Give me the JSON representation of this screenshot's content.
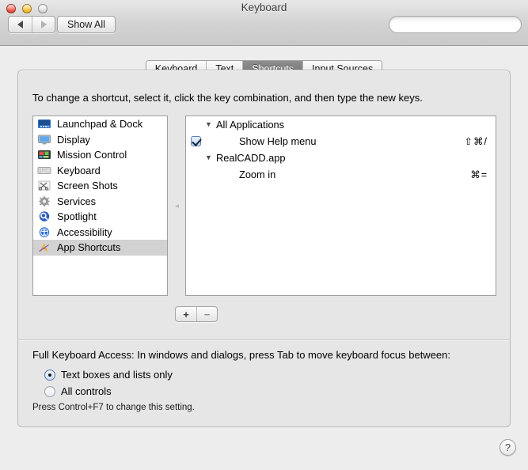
{
  "window": {
    "title": "Keyboard",
    "traffic_lights": [
      "close",
      "minimize",
      "zoom"
    ]
  },
  "toolbar": {
    "back_icon": "back-arrow-icon",
    "forward_icon": "forward-arrow-icon",
    "show_all_label": "Show All",
    "search_placeholder": "",
    "search_value": "",
    "search_icon": "search-icon"
  },
  "tabs": [
    {
      "label": "Keyboard",
      "active": false
    },
    {
      "label": "Text",
      "active": false
    },
    {
      "label": "Shortcuts",
      "active": true
    },
    {
      "label": "Input Sources",
      "active": false
    }
  ],
  "main": {
    "hint": "To change a shortcut, select it, click the key combination, and then type the new keys.",
    "sidebar": [
      {
        "label": "Launchpad & Dock",
        "icon": "launchpad-dock-icon",
        "selected": false
      },
      {
        "label": "Display",
        "icon": "display-icon",
        "selected": false
      },
      {
        "label": "Mission Control",
        "icon": "mission-control-icon",
        "selected": false
      },
      {
        "label": "Keyboard",
        "icon": "keyboard-icon",
        "selected": false
      },
      {
        "label": "Screen Shots",
        "icon": "screenshots-icon",
        "selected": false
      },
      {
        "label": "Services",
        "icon": "services-gear-icon",
        "selected": false
      },
      {
        "label": "Spotlight",
        "icon": "spotlight-icon",
        "selected": false
      },
      {
        "label": "Accessibility",
        "icon": "accessibility-icon",
        "selected": false
      },
      {
        "label": "App Shortcuts",
        "icon": "app-shortcuts-icon",
        "selected": true
      }
    ],
    "shortcut_tree": [
      {
        "type": "group",
        "label": "All Applications",
        "expanded": true,
        "triangle": "▼"
      },
      {
        "type": "item",
        "label": "Show Help menu",
        "keys": "⇧⌘/",
        "checked": true
      },
      {
        "type": "group",
        "label": "RealCADD.app",
        "expanded": true,
        "triangle": "▼"
      },
      {
        "type": "item",
        "label": "Zoom in",
        "keys": "⌘=",
        "checked": false
      }
    ],
    "add_button_label": "+",
    "remove_button_label": "−"
  },
  "full_keyboard_access": {
    "label": "Full Keyboard Access: In windows and dialogs, press Tab to move keyboard focus between:",
    "options": [
      {
        "label": "Text boxes and lists only",
        "selected": true
      },
      {
        "label": "All controls",
        "selected": false
      }
    ],
    "note": "Press Control+F7 to change this setting."
  },
  "help": {
    "label": "?"
  },
  "colors": {
    "accent": "#3b6ea5",
    "window_bg": "#ededed",
    "content_bg": "#e6e6e6",
    "selected_row": "#d2d2d2",
    "active_tab": "#7e7e7e"
  }
}
